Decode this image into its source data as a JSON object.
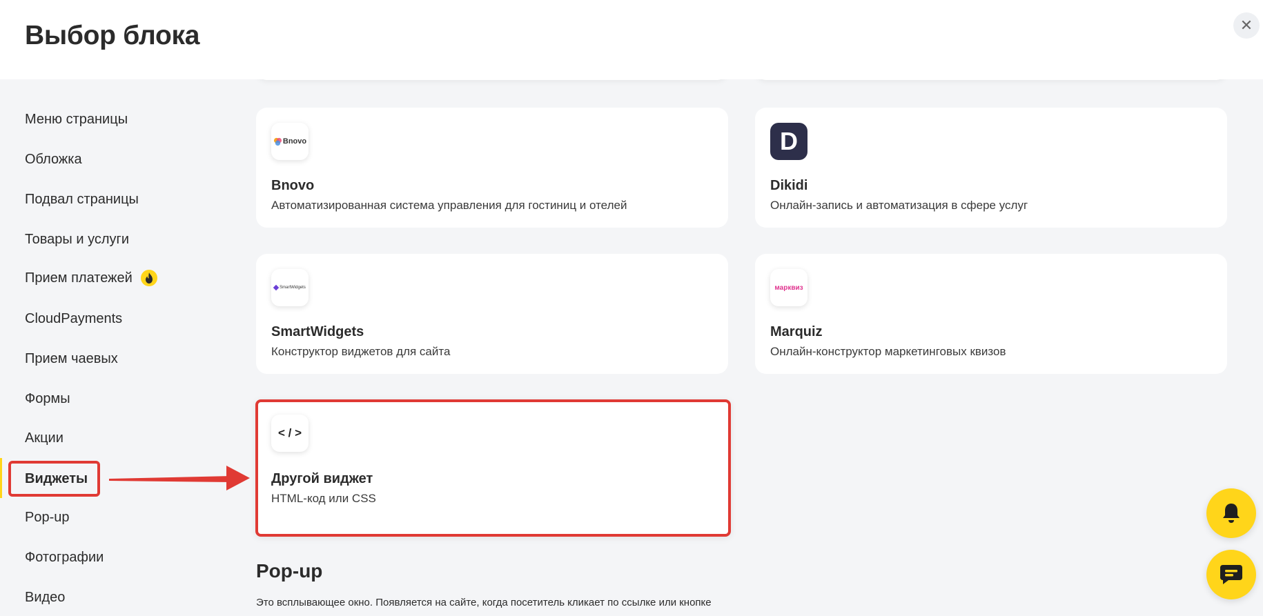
{
  "header": {
    "title": "Выбор блока",
    "close_symbol": "✕"
  },
  "sidebar": {
    "items": [
      {
        "label": "Меню страницы"
      },
      {
        "label": "Обложка"
      },
      {
        "label": "Подвал страницы"
      },
      {
        "label": "Товары и услуги"
      },
      {
        "label": "Прием платежей",
        "badge": "fire-icon"
      },
      {
        "label": "CloudPayments"
      },
      {
        "label": "Прием чаевых"
      },
      {
        "label": "Формы"
      },
      {
        "label": "Акции"
      },
      {
        "label": "Виджеты",
        "active": true
      },
      {
        "label": "Pop-up"
      },
      {
        "label": "Фотографии"
      },
      {
        "label": "Видео"
      }
    ]
  },
  "cards": [
    {
      "name": "Bnovo",
      "description": "Автоматизированная система управления для гостиниц и отелей",
      "logo_text": "Bnovo",
      "icon": "bnovo-logo"
    },
    {
      "name": "Dikidi",
      "description": "Онлайн-запись и автоматизация в сфере услуг",
      "logo_text": "D",
      "icon": "dikidi-logo"
    },
    {
      "name": "SmartWidgets",
      "description": "Конструктор виджетов для сайта",
      "logo_text": "SmartWidgets",
      "icon": "smartwidgets-logo"
    },
    {
      "name": "Marquiz",
      "description": "Онлайн-конструктор маркетинговых квизов",
      "logo_text": "марквиз",
      "icon": "marquiz-logo"
    },
    {
      "name": "Другой виджет",
      "description": "HTML-код или CSS",
      "logo_text": "< / >",
      "icon": "code-icon"
    }
  ],
  "section": {
    "title": "Pop-up",
    "description": "Это всплывающее окно. Появляется на сайте, когда посетитель кликает по ссылке или кнопке"
  },
  "colors": {
    "accent": "#ffd51a",
    "highlight": "#e03a34",
    "background": "#f4f5f7",
    "dikidi": "#2d2f4a",
    "marquiz": "#e0348f"
  }
}
